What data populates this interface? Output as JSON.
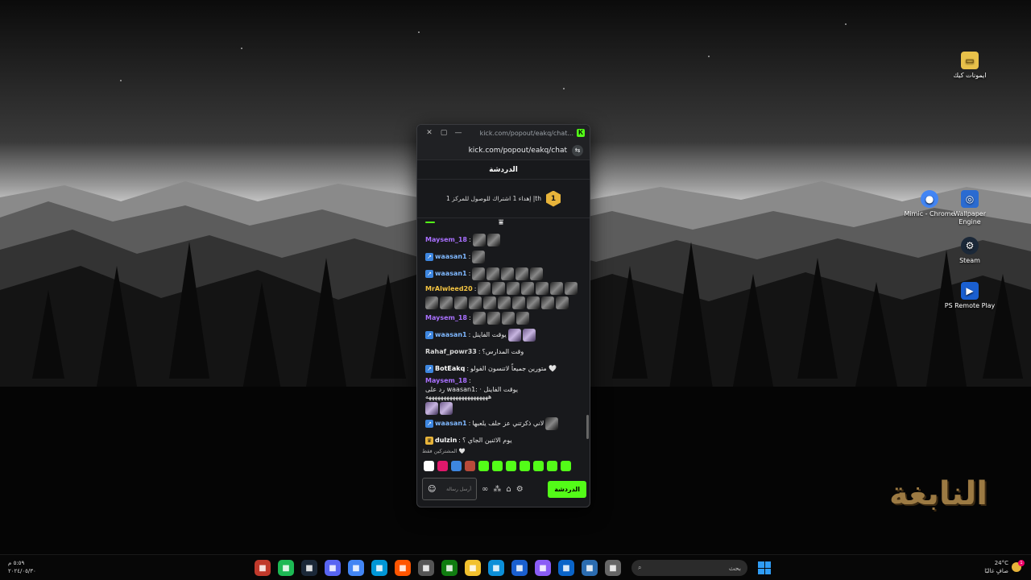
{
  "desktop": {
    "icons": [
      {
        "label": "ايمونات كيك",
        "icon": "folder-icon",
        "color": "#e8c14a"
      },
      {
        "label": "Mimic - Chrome",
        "icon": "chrome-icon",
        "color": "#4285f4"
      },
      {
        "label": "Wallpaper Engine",
        "icon": "wallpaper-engine-icon",
        "color": "#2a6bd1"
      },
      {
        "label": "Steam",
        "icon": "steam-icon",
        "color": "#1b2838"
      },
      {
        "label": "PS Remote Play",
        "icon": "ps-remote-play-icon",
        "color": "#1a5fd0"
      }
    ],
    "watermark": "النابغة"
  },
  "window": {
    "title": "kick.com/popout/eakq/chat...",
    "url": "kick.com/popout/eakq/chat",
    "controls": {
      "close": "✕",
      "maximize": "▢",
      "minimize": "—"
    }
  },
  "chat": {
    "header": "الدردشة",
    "sub_goal": {
      "text": "إهداء 1 اشتراك للوصول للمركز 1 |th",
      "rank": "1"
    },
    "messages": [
      {
        "user": "Maysem_18",
        "user_color": "#a970ff",
        "badge": "",
        "text": "",
        "emotes": [
          "d",
          "d"
        ]
      },
      {
        "user": "waasan1",
        "user_color": "#7fb8ff",
        "badge": "bot",
        "text": "",
        "emotes": [
          "d"
        ]
      },
      {
        "user": "waasan1",
        "user_color": "#7fb8ff",
        "badge": "bot",
        "text": "",
        "emotes": [
          "d",
          "d",
          "d",
          "d",
          "d"
        ]
      },
      {
        "user": "MrAlwleed20",
        "user_color": "#f5c542",
        "badge": "",
        "text": "",
        "emotes": [
          "d",
          "d",
          "d",
          "d",
          "d",
          "d",
          "d",
          "d",
          "d",
          "d",
          "d",
          "d",
          "d",
          "d",
          "d",
          "d",
          "d"
        ]
      },
      {
        "user": "Maysem_18",
        "user_color": "#a970ff",
        "badge": "",
        "text": "",
        "emotes": [
          "d",
          "d",
          "d",
          "d"
        ]
      },
      {
        "user": "waasan1",
        "user_color": "#7fb8ff",
        "badge": "bot",
        "text": "يوقت الفاينل",
        "emotes": [
          "p",
          "p"
        ]
      },
      {
        "user": "Rahaf_powr33",
        "user_color": "#d9d9d9",
        "badge": "",
        "text": "وقت المدارس؟",
        "emotes": []
      },
      {
        "user": "BotEakq",
        "user_color": "#ffffff",
        "badge": "bot",
        "text": "متورين جميعاً لاتنسون الفولو 🤍",
        "emotes": []
      },
      {
        "user": "Maysem_18",
        "user_color": "#a970ff",
        "badge": "",
        "text": "رد على waasan1: يوقت الفاينل · هههههههههههههههههههههه",
        "emotes": [
          "p",
          "p"
        ]
      },
      {
        "user": "waasan1",
        "user_color": "#7fb8ff",
        "badge": "bot",
        "text": "لاني ذكرتني عز حلف يلعبها",
        "emotes": [
          "d"
        ]
      },
      {
        "user": "dulzin",
        "user_color": "#ffffff",
        "badge": "crown",
        "text": "يوم الاثنين الجاي ؟",
        "emotes": []
      }
    ],
    "subscribers_only": "المشتركين فقط 🤍",
    "emote_bar": [
      "#ffffff",
      "#e0186b",
      "#3d86e0",
      "#b84a3a",
      "#53fc18",
      "#53fc18",
      "#53fc18",
      "#53fc18",
      "#53fc18",
      "#53fc18",
      "#53fc18"
    ],
    "input_placeholder": "أرسل رسالة",
    "send_label": "الدردشة"
  },
  "taskbar": {
    "clock_time": "٥:٥٩ م",
    "clock_date": "٢٠٢٤/٠٥/٣٠",
    "search_placeholder": "بحث",
    "weather_temp": "24°C",
    "weather_desc": "صافٍ غالبًا",
    "weather_badge": "1",
    "apps": [
      {
        "icon": "screen-recorder-icon",
        "color": "#c0392b"
      },
      {
        "icon": "spotify-icon",
        "color": "#1db954"
      },
      {
        "icon": "steam-icon",
        "color": "#1b2838"
      },
      {
        "icon": "discord-icon",
        "color": "#5865f2"
      },
      {
        "icon": "chrome-icon",
        "color": "#4285f4"
      },
      {
        "icon": "hp-icon",
        "color": "#0096d6"
      },
      {
        "icon": "soundcloud-icon",
        "color": "#ff5500"
      },
      {
        "icon": "settings-icon",
        "color": "#555555"
      },
      {
        "icon": "xbox-app-icon",
        "color": "#107c10"
      },
      {
        "icon": "file-explorer-icon",
        "color": "#f2c12e"
      },
      {
        "icon": "edge-icon",
        "color": "#0c8fd8"
      },
      {
        "icon": "ps-remote-play-icon",
        "color": "#1a5fd0"
      },
      {
        "icon": "copilot-icon",
        "color": "#8a5cf6"
      },
      {
        "icon": "outlook-icon",
        "color": "#0a64c8"
      },
      {
        "icon": "microsoft-store-icon",
        "color": "#2b6cb0"
      },
      {
        "icon": "task-view-icon",
        "color": "#666666"
      }
    ]
  }
}
